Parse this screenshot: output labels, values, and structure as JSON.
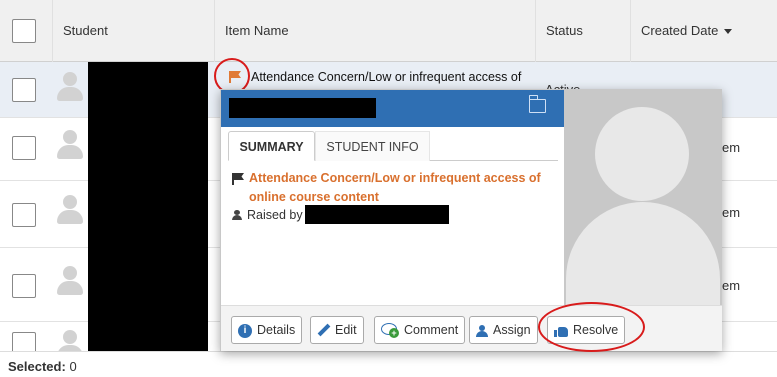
{
  "table": {
    "headers": {
      "select": "",
      "student": "Student",
      "item_name": "Item Name",
      "status": "Status",
      "created_date": "Created Date"
    },
    "rows": [
      {
        "item_name": "Attendance Concern/Low or infrequent access of",
        "status": "Active",
        "created_date_fragment": ""
      },
      {
        "created_date_fragment": "em"
      },
      {
        "created_date_fragment": "em"
      },
      {
        "created_date_fragment": "em"
      },
      {
        "created_date_fragment": ""
      }
    ]
  },
  "popover": {
    "tabs": [
      "SUMMARY",
      "STUDENT INFO"
    ],
    "active_tab": "SUMMARY",
    "summary_title": "Attendance Concern/Low or infrequent access of online course content",
    "raised_by_label": "Raised by",
    "buttons": {
      "details": "Details",
      "edit": "Edit",
      "comment": "Comment",
      "assign": "Assign",
      "resolve": "Resolve"
    }
  },
  "footer": {
    "selected_label": "Selected:",
    "selected_count": "0"
  },
  "icons": {
    "flag_color": "#e07a36",
    "header_color": "#2f6fb3",
    "annotation_color": "#d81b1b"
  }
}
